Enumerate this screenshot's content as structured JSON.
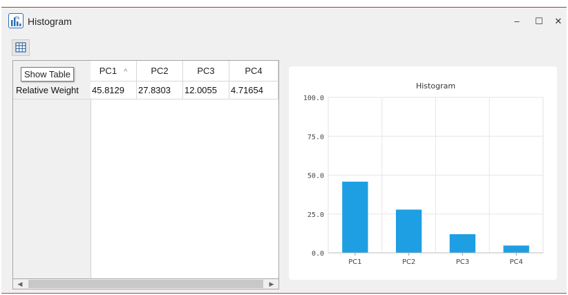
{
  "window": {
    "title": "Histogram",
    "minimize_glyph": "–",
    "maximize_glyph": "☐",
    "close_glyph": "✕"
  },
  "toolbar": {
    "show_table_icon": "table-grid-icon"
  },
  "tooltip": "Show Table",
  "table": {
    "columns": [
      "PC1",
      "PC2",
      "PC3",
      "PC4"
    ],
    "sort_indicator": "^",
    "rows": [
      {
        "label": "Relative Weight",
        "values": [
          "45.8129",
          "27.8303",
          "12.0055",
          "4.71654"
        ]
      }
    ]
  },
  "scrollbar": {
    "left_arrow": "◀",
    "right_arrow": "▶"
  },
  "chart_data": {
    "type": "bar",
    "title": "Histogram",
    "categories": [
      "PC1",
      "PC2",
      "PC3",
      "PC4"
    ],
    "values": [
      45.8129,
      27.8303,
      12.0055,
      4.71654
    ],
    "ylim": [
      0,
      100
    ],
    "yticks": [
      "0.0",
      "25.0",
      "50.0",
      "75.0",
      "100.0"
    ],
    "grid": true,
    "bar_color": "#1e9fe3"
  }
}
